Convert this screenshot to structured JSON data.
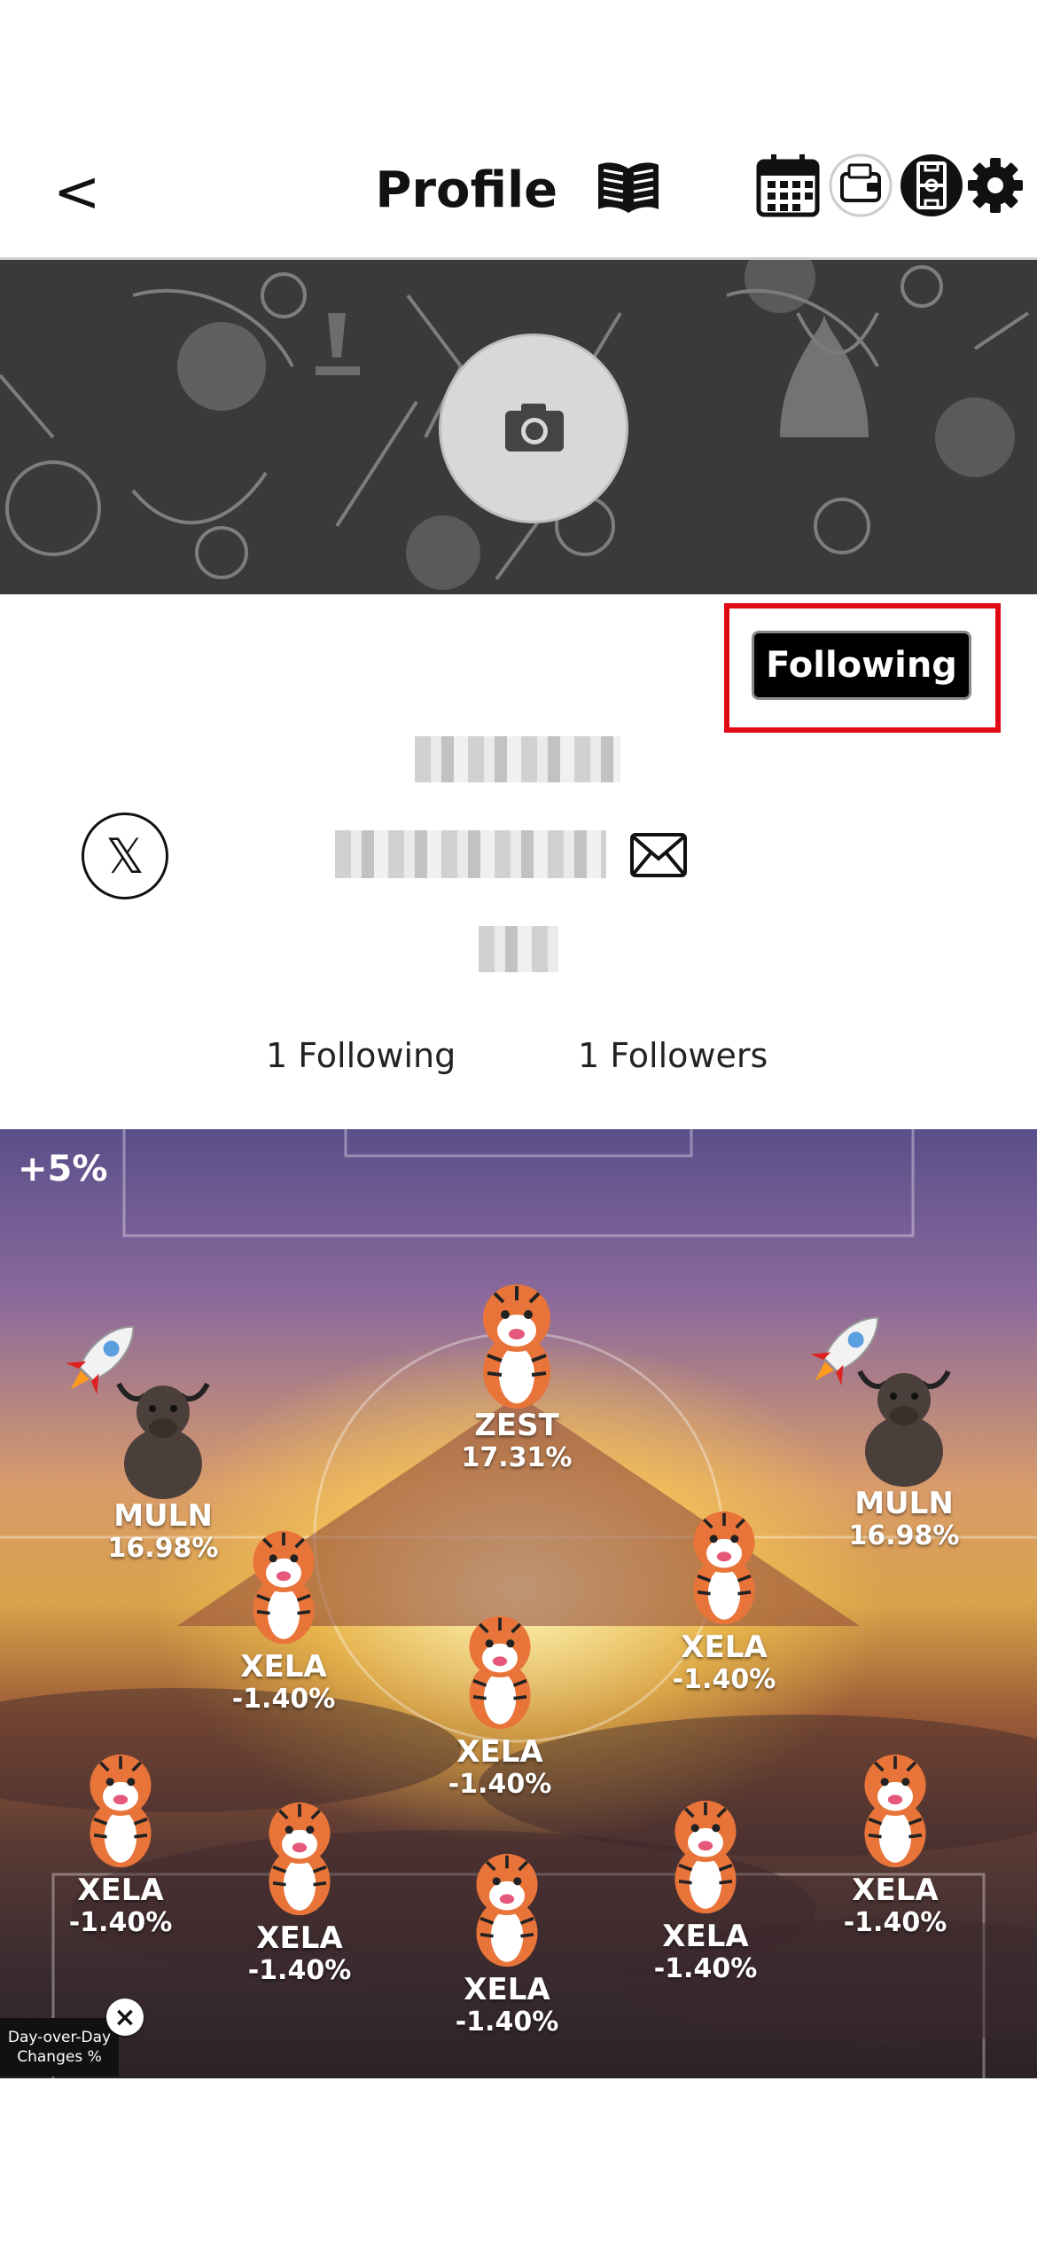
{
  "header": {
    "back_label": "<",
    "title": "Profile",
    "icons": [
      "book-icon",
      "calendar-icon",
      "wallet-icon",
      "pitch-icon",
      "gear-icon"
    ]
  },
  "profile": {
    "follow_button_label": "Following",
    "social_icon": "x-icon",
    "contact_icon": "mail-icon",
    "following_count": "1",
    "following_label": "Following",
    "followers_count": "1",
    "followers_label": "Followers"
  },
  "formation": {
    "percent_label": "+5%",
    "players": [
      {
        "name": "ZEST",
        "change": "17.31%",
        "animal": "tiger"
      },
      {
        "name": "MULN",
        "change": "16.98%",
        "animal": "bull"
      },
      {
        "name": "MULN",
        "change": "16.98%",
        "animal": "bull"
      },
      {
        "name": "XELA",
        "change": "-1.40%",
        "animal": "tiger"
      },
      {
        "name": "XELA",
        "change": "-1.40%",
        "animal": "tiger"
      },
      {
        "name": "XELA",
        "change": "-1.40%",
        "animal": "tiger"
      },
      {
        "name": "XELA",
        "change": "-1.40%",
        "animal": "tiger"
      },
      {
        "name": "XELA",
        "change": "-1.40%",
        "animal": "tiger"
      },
      {
        "name": "XELA",
        "change": "-1.40%",
        "animal": "tiger"
      },
      {
        "name": "XELA",
        "change": "-1.40%",
        "animal": "tiger"
      },
      {
        "name": "XELA",
        "change": "-1.40%",
        "animal": "tiger"
      }
    ],
    "legend_line1": "Day-over-Day",
    "legend_line2": "Changes %",
    "legend_close": "×"
  }
}
